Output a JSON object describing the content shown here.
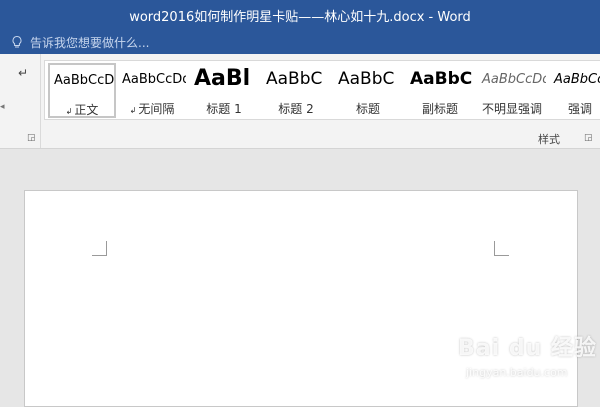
{
  "window": {
    "title": "word2016如何制作明星卡贴——林心如十九.docx - Word"
  },
  "tell_me": {
    "placeholder": "告诉我您想要做什么..."
  },
  "ribbon": {
    "paragraph_mark": "↵",
    "styles_group_label": "样式",
    "styles": [
      {
        "sample": "AaBbCcDd",
        "name": "正文",
        "marker": "↲",
        "selected": true
      },
      {
        "sample": "AaBbCcDd",
        "name": "无间隔",
        "marker": "↲"
      },
      {
        "sample": "AaBl",
        "name": "标题 1"
      },
      {
        "sample": "AaBbC",
        "name": "标题 2"
      },
      {
        "sample": "AaBbC",
        "name": "标题"
      },
      {
        "sample": "AaBbC",
        "name": "副标题"
      },
      {
        "sample": "AaBbCcDd",
        "name": "不明显强调"
      },
      {
        "sample": "AaBbCcD",
        "name": "强调"
      }
    ]
  },
  "watermark": {
    "logo": "Bai du 经验",
    "url": "jingyan.baidu.com"
  }
}
